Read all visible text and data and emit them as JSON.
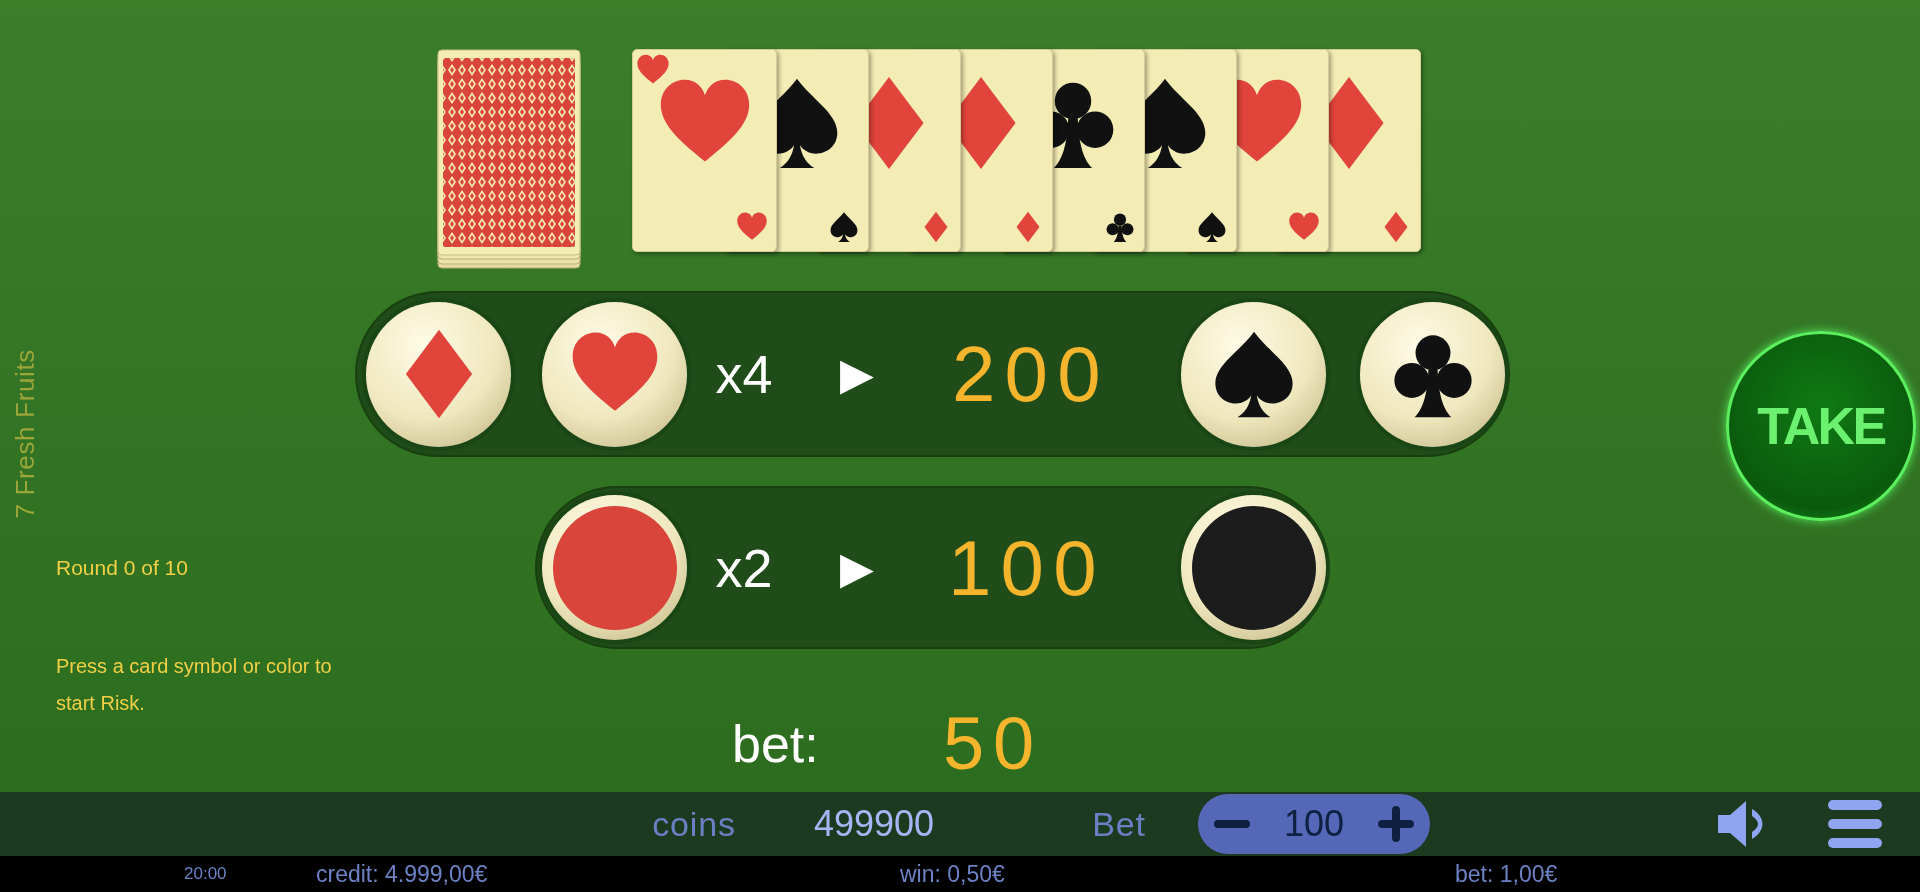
{
  "game_title": "7 Fresh Fruits",
  "history": [
    {
      "kind": "hearts"
    },
    {
      "kind": "spades"
    },
    {
      "kind": "diamonds"
    },
    {
      "kind": "diamonds"
    },
    {
      "kind": "clubs"
    },
    {
      "kind": "spades"
    },
    {
      "kind": "hearts"
    },
    {
      "kind": "diamonds"
    }
  ],
  "round": "Round 0 of 10",
  "hint": "Press a card symbol or color to start Risk.",
  "suit_bet": {
    "multiplier": "x4",
    "arrow": "▶",
    "win": "200",
    "left_options": [
      {
        "kind": "diamonds"
      },
      {
        "kind": "hearts"
      }
    ],
    "right_options": [
      {
        "kind": "spades"
      },
      {
        "kind": "clubs"
      }
    ]
  },
  "color_bet": {
    "multiplier": "x2",
    "arrow": "▶",
    "win": "100",
    "left_option": {
      "color": "#d9453a"
    },
    "right_option": {
      "color": "#1c1c1c"
    }
  },
  "bet": {
    "label": "bet:",
    "value": "50"
  },
  "take_button": "TAKE",
  "control_bar": {
    "coins_label": "coins",
    "coins_value": "499900",
    "bet_label": "Bet",
    "bet_value": "100"
  },
  "status_bar": {
    "time": "20:00",
    "credit": "credit: 4.999,00€",
    "win": "win: 0,50€",
    "bet": "bet: 1,00€"
  }
}
